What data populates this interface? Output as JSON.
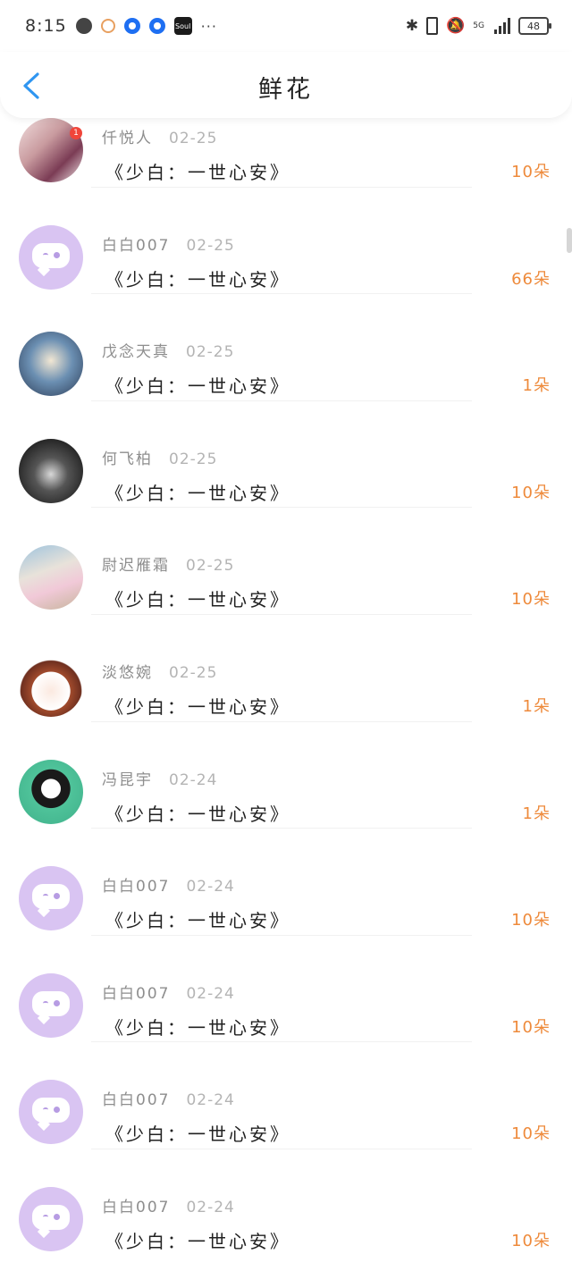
{
  "status_bar": {
    "time": "8:15",
    "network": "5G",
    "battery": "48",
    "icons": [
      "globe-icon",
      "orange-app-icon",
      "blue-app-icon",
      "blue-app-icon",
      "soul-app-icon",
      "bluetooth-icon",
      "vibrate-icon",
      "mute-icon",
      "signal-icon",
      "battery-icon"
    ],
    "soul_label": "Soul",
    "more": "···"
  },
  "header": {
    "title": "鲜花",
    "back_icon": "chevron-left-icon",
    "accent_color": "#2f96f1"
  },
  "colors": {
    "count": "#ee8a3b",
    "name": "#8e8e8e",
    "avatar_placeholder": "#d9c4f2"
  },
  "items": [
    {
      "name": "仟悦人",
      "date": "02-25",
      "gift": "《少白：一世心安》",
      "count": "10朵",
      "avatar": "photo",
      "badge": "1"
    },
    {
      "name": "白白007",
      "date": "02-25",
      "gift": "《少白：一世心安》",
      "count": "66朵",
      "avatar": "placeholder"
    },
    {
      "name": "戊念天真",
      "date": "02-25",
      "gift": "《少白：一世心安》",
      "count": "1朵",
      "avatar": "anime"
    },
    {
      "name": "何飞柏",
      "date": "02-25",
      "gift": "《少白：一世心安》",
      "count": "10朵",
      "avatar": "dark"
    },
    {
      "name": "尉迟雁霜",
      "date": "02-25",
      "gift": "《少白：一世心安》",
      "count": "10朵",
      "avatar": "store"
    },
    {
      "name": "淡悠婉",
      "date": "02-25",
      "gift": "《少白：一世心安》",
      "count": "1朵",
      "avatar": "girl"
    },
    {
      "name": "冯昆宇",
      "date": "02-24",
      "gift": "《少白：一世心安》",
      "count": "1朵",
      "avatar": "maruko"
    },
    {
      "name": "白白007",
      "date": "02-24",
      "gift": "《少白：一世心安》",
      "count": "10朵",
      "avatar": "placeholder"
    },
    {
      "name": "白白007",
      "date": "02-24",
      "gift": "《少白：一世心安》",
      "count": "10朵",
      "avatar": "placeholder"
    },
    {
      "name": "白白007",
      "date": "02-24",
      "gift": "《少白：一世心安》",
      "count": "10朵",
      "avatar": "placeholder"
    },
    {
      "name": "白白007",
      "date": "02-24",
      "gift": "《少白：一世心安》",
      "count": "10朵",
      "avatar": "placeholder"
    }
  ]
}
